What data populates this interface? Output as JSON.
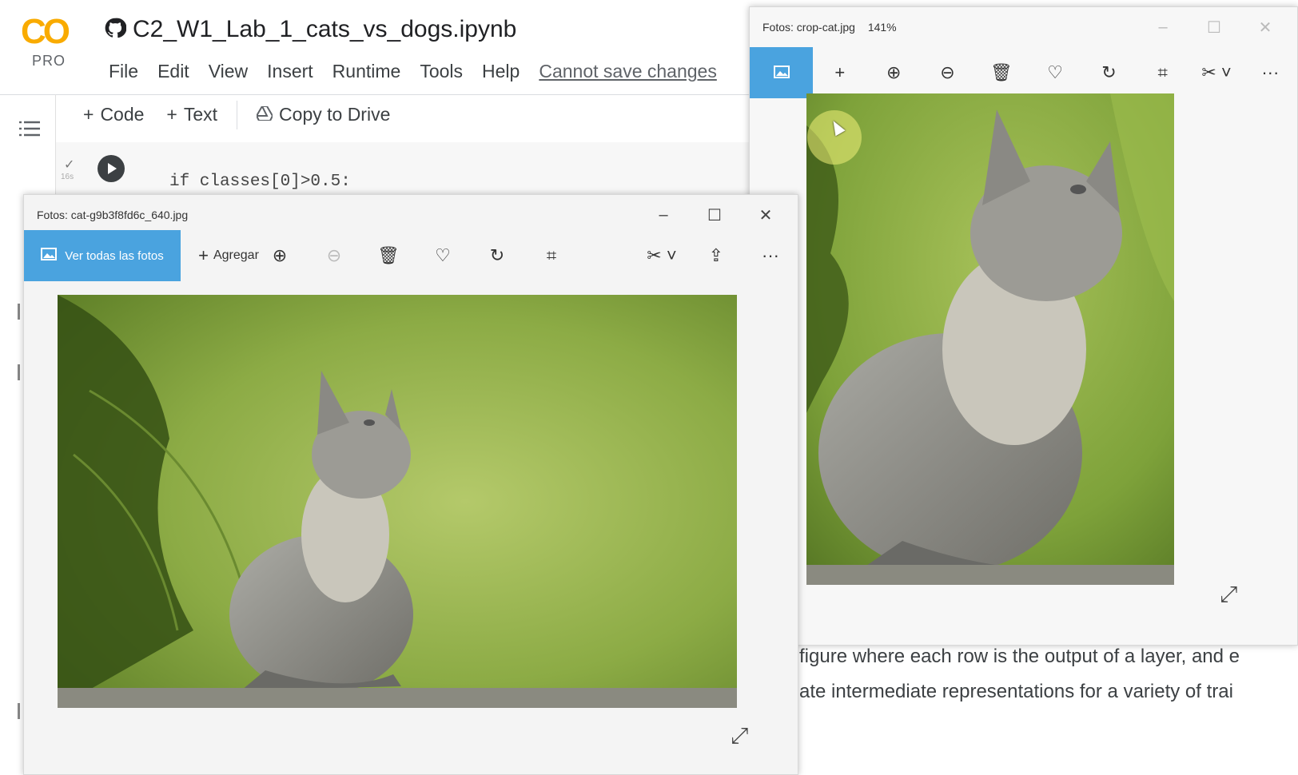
{
  "colab": {
    "logo_text": "CO",
    "tier": "PRO",
    "notebook_title": "C2_W1_Lab_1_cats_vs_dogs.ipynb",
    "menu": [
      "File",
      "Edit",
      "View",
      "Insert",
      "Runtime",
      "Tools",
      "Help"
    ],
    "save_warning": "Cannot save changes",
    "toolbar": {
      "code": "Code",
      "text": "Text",
      "copy": "Copy to Drive"
    },
    "code_line": "if classes[0]>0.5:",
    "exec_time": "16s",
    "text_lines": [
      "figure where each row is the output of a layer, and e",
      "ate intermediate representations for a variety of trai"
    ]
  },
  "photos_crop": {
    "title": "Fotos: crop-cat.jpg",
    "zoom": "141%"
  },
  "photos_main": {
    "title": "Fotos: cat-g9b3f8fd6c_640.jpg",
    "view_all": "Ver todas las fotos",
    "add": "Agregar"
  },
  "colors": {
    "accent": "#4aa3df",
    "colab_orange": "#f9ab00"
  }
}
